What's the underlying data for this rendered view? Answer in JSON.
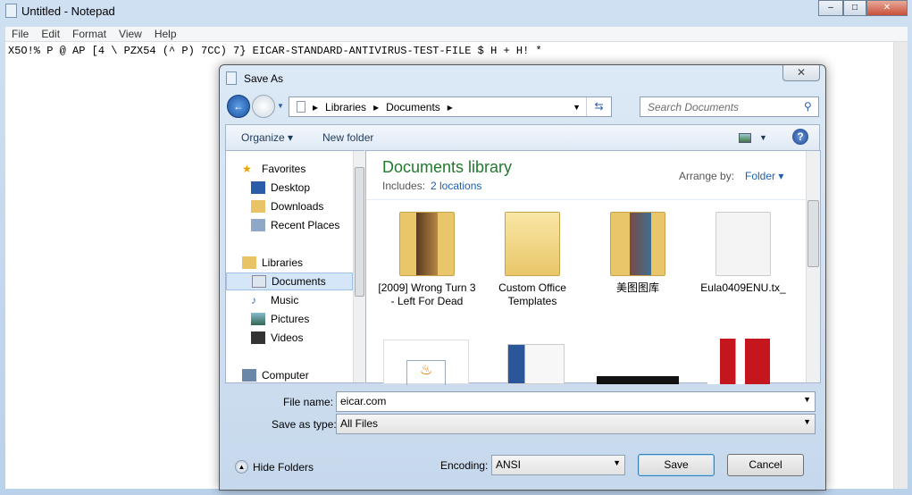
{
  "notepad": {
    "title": "Untitled - Notepad",
    "menu": [
      "File",
      "Edit",
      "Format",
      "View",
      "Help"
    ],
    "content": "X5O!% P @ AP [4 \\ PZX54 (^ P) 7CC) 7} EICAR-STANDARD-ANTIVIRUS-TEST-FILE $ H + H! *",
    "controls": [
      "–",
      "□",
      "✕"
    ]
  },
  "dialog": {
    "title": "Save As",
    "close": "✕",
    "breadcrumb": [
      "Libraries",
      "Documents"
    ],
    "search_placeholder": "Search Documents",
    "toolbar": {
      "organize": "Organize ▾",
      "new_folder": "New folder"
    },
    "nav": [
      {
        "label": "Favorites",
        "icon": "star-icon"
      },
      {
        "label": "Desktop",
        "icon": "desktop-icon"
      },
      {
        "label": "Downloads",
        "icon": "downloads-icon"
      },
      {
        "label": "Recent Places",
        "icon": "recent-places-icon"
      },
      {
        "label": "Libraries",
        "icon": "libraries-icon"
      },
      {
        "label": "Documents",
        "icon": "documents-icon"
      },
      {
        "label": "Music",
        "icon": "music-icon"
      },
      {
        "label": "Pictures",
        "icon": "pictures-icon"
      },
      {
        "label": "Videos",
        "icon": "videos-icon"
      },
      {
        "label": "Computer",
        "icon": "computer-icon"
      }
    ],
    "library_title": "Documents library",
    "includes_label": "Includes:",
    "includes_link": "2 locations",
    "arrange_label": "Arrange by:",
    "arrange_value": "Folder",
    "files": [
      {
        "name": "[2009] Wrong Turn 3 - Left For Dead",
        "type": "folder"
      },
      {
        "name": "Custom Office Templates",
        "type": "folder"
      },
      {
        "name": "美图图库",
        "type": "folder"
      },
      {
        "name": "Eula0409ENU.tx_",
        "type": "file"
      }
    ],
    "file_name_label": "File name:",
    "file_name": "eicar.com",
    "save_type_label": "Save as type:",
    "save_type": "All Files",
    "hide_folders": "Hide Folders",
    "encoding_label": "Encoding:",
    "encoding": "ANSI",
    "save": "Save",
    "cancel": "Cancel"
  }
}
